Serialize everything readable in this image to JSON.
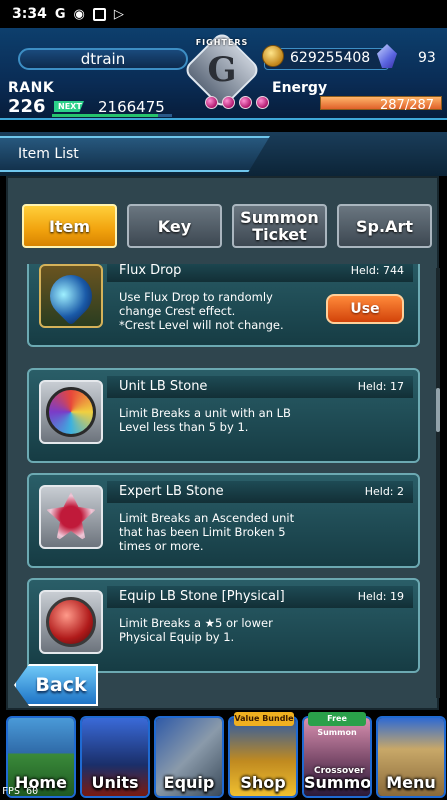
{
  "status_bar": {
    "time": "3:34",
    "icons": [
      "google-icon",
      "notification-icon",
      "gallery-icon",
      "play-icon"
    ]
  },
  "header": {
    "player_name": "dtrain",
    "rank_label": "RANK",
    "rank": "226",
    "next_label": "NEXT",
    "next_exp": "2166475",
    "logo_banner": "FIGHTERS",
    "logo_letter": "G",
    "gil": "629255408",
    "lapis": "93",
    "energy_label": "Energy",
    "energy": "287/287",
    "energy_fraction": 1.0
  },
  "title": "Item List",
  "tabs": [
    {
      "label": "Item",
      "active": true
    },
    {
      "label": "Key",
      "active": false
    },
    {
      "label": "Summon\nTicket",
      "active": false
    },
    {
      "label": "Sp.Art",
      "active": false
    }
  ],
  "items": [
    {
      "name": "Flux Drop",
      "held": "Held: 744",
      "desc": "Use Flux Drop to randomly\nchange Crest effect.\n*Crest Level will not change.",
      "use_label": "Use",
      "icon": "flux-drop-icon"
    },
    {
      "name": "Unit LB Stone",
      "held": "Held: 17",
      "desc": "Limit Breaks a unit with an LB\nLevel less than 5 by 1.",
      "icon": "unit-lb-stone-icon"
    },
    {
      "name": "Expert LB Stone",
      "held": "Held: 2",
      "desc": "Limit Breaks an Ascended unit\nthat has been Limit Broken 5\ntimes or more.",
      "icon": "expert-lb-stone-icon"
    },
    {
      "name": "Equip LB Stone [Physical]",
      "held": "Held: 19",
      "desc": "Limit Breaks a ★5 or lower\nPhysical Equip by 1.",
      "icon": "equip-lb-stone-icon"
    }
  ],
  "back_label": "Back",
  "nav": [
    {
      "label": "Home"
    },
    {
      "label": "Units"
    },
    {
      "label": "Equip"
    },
    {
      "label": "Shop",
      "tag": "Value Bundle"
    },
    {
      "label": "Summon",
      "tag": "Free Summon",
      "sub": "Crossover"
    },
    {
      "label": "Menu"
    }
  ],
  "fps_label": "FPS",
  "fps": "60"
}
